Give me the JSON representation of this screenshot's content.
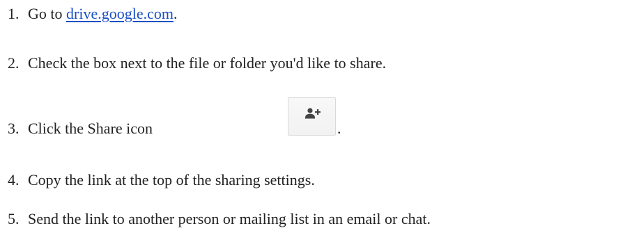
{
  "steps": [
    {
      "number": "1.",
      "prefix": "Go to ",
      "link_text": "drive.google.com",
      "suffix": "."
    },
    {
      "number": "2.",
      "text": "Check the box next to the file or folder you'd like to share."
    },
    {
      "number": "3.",
      "text": "Click the Share icon",
      "suffix": ".",
      "icon": "add-person-icon"
    },
    {
      "number": "4.",
      "text": "Copy the link at the top of the sharing settings."
    },
    {
      "number": "5.",
      "text": "Send the link to another person or mailing list in an email or chat."
    }
  ],
  "colors": {
    "text": "#222222",
    "link": "#1a4fc4",
    "icon": "#444444",
    "button_border": "#d9d9d9"
  }
}
